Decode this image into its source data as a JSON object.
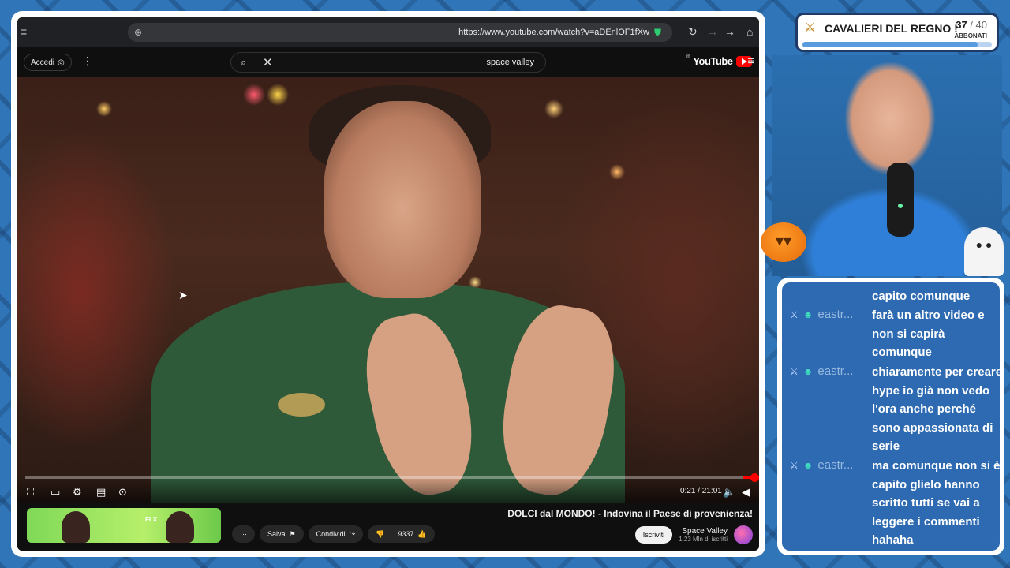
{
  "browser": {
    "url": "https://www.youtube.com/watch?v=aDEnlOF1fXw"
  },
  "youtube": {
    "logo_text": "YouTube",
    "logo_region": "IT",
    "search_query": "space valley",
    "signin_label": "Accedi"
  },
  "video": {
    "time": "0:21 / 21:01",
    "progress_fraction": 0.017,
    "title": "DOLCI dal MONDO! - Indovina il Paese di provenienza!",
    "channel_name": "Space Valley",
    "channel_subs": "1,23 Mln di iscritti",
    "subscribe_label": "Iscriviti",
    "likes": "9337",
    "share_label": "Condividi",
    "save_label": "Salva",
    "more_label": "···",
    "recommended_badge": "FLX"
  },
  "overlay": {
    "goal_title": "CAVALIERI DEL REGNO !",
    "goal_current": "37",
    "goal_total": "/ 40",
    "goal_label": "ABBONATI",
    "goal_fraction": 0.925
  },
  "chat": {
    "messages": [
      {
        "user": "",
        "text": "capito comunque"
      },
      {
        "user": "eastr...",
        "text": "farà un altro video e non si capirà comunque"
      },
      {
        "user": "eastr...",
        "text": "chiaramente per creare hype io già non vedo l'ora anche perché sono appassionata di serie"
      },
      {
        "user": "eastr...",
        "text": "ma comunque non si è capito glielo hanno scritto tutti se vai a leggere i commenti hahaha"
      }
    ]
  },
  "colors": {
    "background": "#2f75b8",
    "chat_bg": "#2d6ab2",
    "yt_red": "#ff0000",
    "goal_fill": "#5a9be0"
  }
}
